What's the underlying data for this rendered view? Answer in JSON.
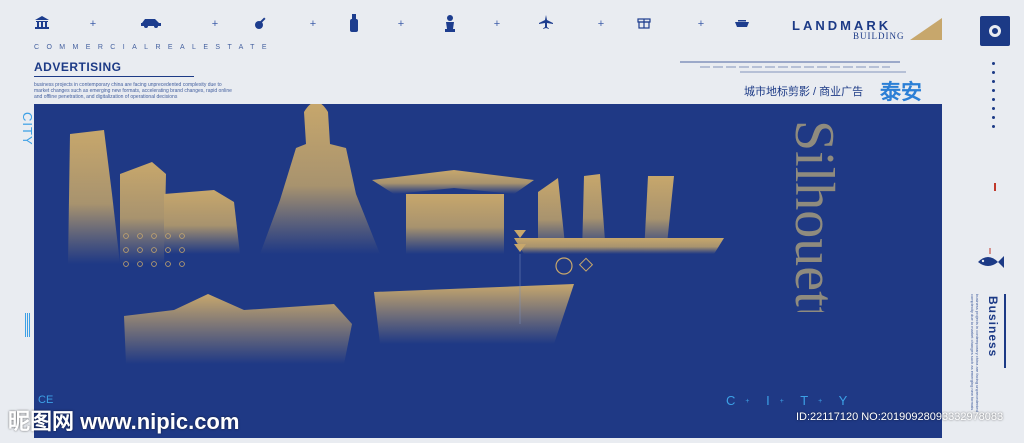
{
  "icons": [
    "bank-icon",
    "car-icon",
    "guitar-icon",
    "bottle-icon",
    "statue-icon",
    "airplane-icon",
    "gift-icon",
    "bowl-icon"
  ],
  "kicker": "COMMERCIALREALESTATE",
  "advertising": {
    "title": "ADVERTISING",
    "description": "business projects in contemporary china are facing unprecedented complexity due to market changes such as emerging new formats, accelerating brand changes, rapid online and offline penetration, and digitalization of operational decisions"
  },
  "landmark": {
    "title": "LANDMARK",
    "subtitle": "BUILDING"
  },
  "header": {
    "cn": "城市地标剪影 / 商业广告",
    "city": "泰安"
  },
  "sil_text": "Silhouette",
  "city_vertical": "CITY",
  "city_footer": [
    "C",
    "I",
    "T",
    "Y"
  ],
  "ce_left": "CE",
  "business": {
    "title": "Business",
    "description": "business projects in contemporary china are facing unprecedented complexity due to market changes such as emerging new formats"
  },
  "watermark": "昵图网 www.nipic.com",
  "image_id": "ID:22117120 NO:20190928093332978083",
  "colors": {
    "panel": "#1f3985",
    "gold": "#c7a76c",
    "accent": "#3ca0e6",
    "navy": "#1c3a86",
    "bg": "#e9ecf1"
  }
}
